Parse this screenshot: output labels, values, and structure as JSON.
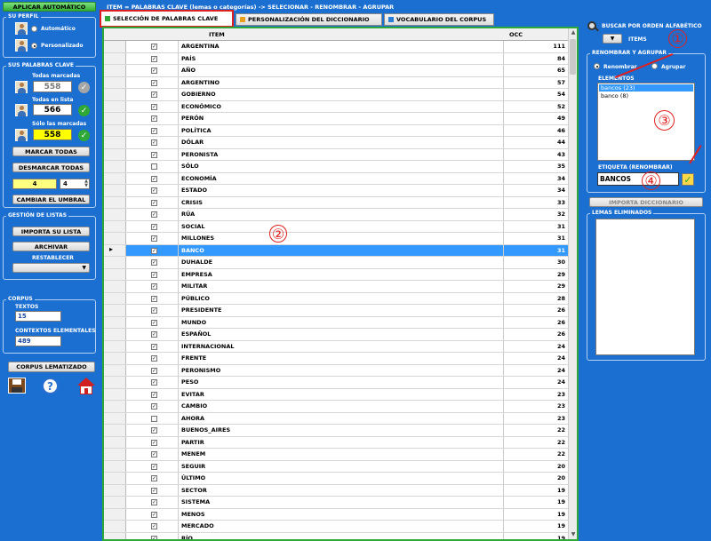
{
  "top": {
    "apply_auto": "APLICAR AUTOMÁTICO",
    "breadcrumb": "ITEM = PALABRAS CLAVE (lemas o categorías) -> SELECIONAR - RENOMBRAR - AGRUPAR"
  },
  "profile": {
    "title": "SU PERFIL",
    "auto": "Automático",
    "personal": "Personalizado"
  },
  "keywords": {
    "title": "SUS PALABRAS CLAVE",
    "all_marked_label": "Todas marcadas",
    "all_marked_value": "558",
    "all_list_label": "Todas en lista",
    "all_list_value": "566",
    "only_marked_label": "Sólo las marcadas",
    "only_marked_value": "558",
    "mark_all": "MARCAR TODAS",
    "unmark_all": "DESMARCAR TODAS",
    "threshold_a": "4",
    "threshold_b": "4",
    "change_threshold": "CAMBIAR EL UMBRAL"
  },
  "lists": {
    "title": "GESTIÓN DE LISTAS",
    "import": "IMPORTA SU LISTA",
    "archive": "ARCHIVAR",
    "restore": "RESTABLECER"
  },
  "corpus": {
    "title": "CORPUS",
    "texts_label": "TEXTOS",
    "texts_value": "15",
    "contexts_label": "CONTEXTOS ELEMENTALES",
    "contexts_value": "489",
    "lemmatized": "CORPUS LEMATIZADO"
  },
  "tabs": [
    {
      "label": "SELECCIÓN DE PALABRAS CLAVE",
      "color": "#2ea836"
    },
    {
      "label": "PERSONALIZACIÓN DEL DICCIONARIO",
      "color": "#e8a020"
    },
    {
      "label": "VOCABULARIO DEL CORPUS",
      "color": "#2a7fd0"
    }
  ],
  "table": {
    "col_item": "ITEM",
    "col_occ": "OCC",
    "rows": [
      {
        "item": "ARGENTINA",
        "occ": "111",
        "checked": true
      },
      {
        "item": "PAÍS",
        "occ": "84",
        "checked": true
      },
      {
        "item": "AÑO",
        "occ": "65",
        "checked": true
      },
      {
        "item": "ARGENTINO",
        "occ": "57",
        "checked": true
      },
      {
        "item": "GOBIERNO",
        "occ": "54",
        "checked": true
      },
      {
        "item": "ECONÓMICO",
        "occ": "52",
        "checked": true
      },
      {
        "item": "PERÓN",
        "occ": "49",
        "checked": true
      },
      {
        "item": "POLÍTICA",
        "occ": "46",
        "checked": true
      },
      {
        "item": "DÓLAR",
        "occ": "44",
        "checked": true
      },
      {
        "item": "PERONISTA",
        "occ": "43",
        "checked": true
      },
      {
        "item": "SÓLO",
        "occ": "35",
        "checked": false
      },
      {
        "item": "ECONOMÍA",
        "occ": "34",
        "checked": true
      },
      {
        "item": "ESTADO",
        "occ": "34",
        "checked": true
      },
      {
        "item": "CRISIS",
        "occ": "33",
        "checked": true
      },
      {
        "item": "RÚA",
        "occ": "32",
        "checked": true
      },
      {
        "item": "SOCIAL",
        "occ": "31",
        "checked": true
      },
      {
        "item": "MILLONES",
        "occ": "31",
        "checked": true
      },
      {
        "item": "BANCO",
        "occ": "31",
        "checked": true,
        "selected": true
      },
      {
        "item": "DUHALDE",
        "occ": "30",
        "checked": true
      },
      {
        "item": "EMPRESA",
        "occ": "29",
        "checked": true
      },
      {
        "item": "MILITAR",
        "occ": "29",
        "checked": true
      },
      {
        "item": "PÚBLICO",
        "occ": "28",
        "checked": true
      },
      {
        "item": "PRESIDENTE",
        "occ": "26",
        "checked": true
      },
      {
        "item": "MUNDO",
        "occ": "26",
        "checked": true
      },
      {
        "item": "ESPAÑOL",
        "occ": "26",
        "checked": true
      },
      {
        "item": "INTERNACIONAL",
        "occ": "24",
        "checked": true
      },
      {
        "item": "FRENTE",
        "occ": "24",
        "checked": true
      },
      {
        "item": "PERONISMO",
        "occ": "24",
        "checked": true
      },
      {
        "item": "PESO",
        "occ": "24",
        "checked": true
      },
      {
        "item": "EVITAR",
        "occ": "23",
        "checked": true
      },
      {
        "item": "CAMBIO",
        "occ": "23",
        "checked": true
      },
      {
        "item": "AHORA",
        "occ": "23",
        "checked": false
      },
      {
        "item": "BUENOS_AIRES",
        "occ": "22",
        "checked": true
      },
      {
        "item": "PARTIR",
        "occ": "22",
        "checked": true
      },
      {
        "item": "MENEM",
        "occ": "22",
        "checked": true
      },
      {
        "item": "SEGUIR",
        "occ": "20",
        "checked": true
      },
      {
        "item": "ÚLTIMO",
        "occ": "20",
        "checked": true
      },
      {
        "item": "SECTOR",
        "occ": "19",
        "checked": true
      },
      {
        "item": "SISTEMA",
        "occ": "19",
        "checked": true
      },
      {
        "item": "MENOS",
        "occ": "19",
        "checked": true
      },
      {
        "item": "MERCADO",
        "occ": "19",
        "checked": true
      },
      {
        "item": "RÍO",
        "occ": "19",
        "checked": true
      }
    ]
  },
  "right": {
    "sort_label": "BUSCAR POR ORDEN ALFABÉTICO",
    "items_label": "ITEMS",
    "rename_group_title": "RENOMBRAR Y AGRUPAR",
    "rename": "Renombrar",
    "group": "Agrupar",
    "elements_label": "ELEMENTOS",
    "elements": [
      "bancos (23)",
      "banco (8)"
    ],
    "tag_label": "ETIQUETA (RENOMBRAR)",
    "tag_value": "BANCOS",
    "import_dict": "IMPORTA DICCIONARIO",
    "deleted_title": "LEMAS ELIMINADOS"
  },
  "annotations": [
    "①",
    "②",
    "③",
    "④"
  ]
}
